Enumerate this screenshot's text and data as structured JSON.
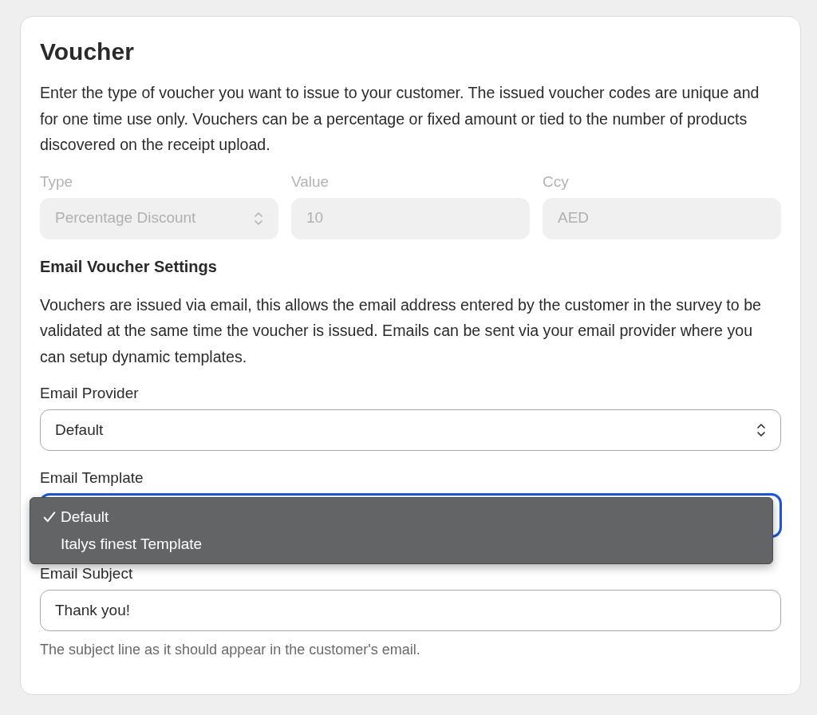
{
  "title": "Voucher",
  "intro": "Enter the type of voucher you want to issue to your customer. The issued voucher codes are unique and for one time use only. Vouchers can be a percentage or fixed amount or tied to the number of products discovered on the receipt upload.",
  "voucher_fields": [
    {
      "label": "Type",
      "kind": "select",
      "value": "Percentage Discount",
      "disabled": true
    },
    {
      "label": "Value",
      "kind": "input",
      "value": "10",
      "disabled": true
    },
    {
      "label": "Ccy",
      "kind": "input",
      "value": "AED",
      "disabled": true
    }
  ],
  "email_section": {
    "heading": "Email Voucher Settings",
    "description": "Vouchers are issued via email, this allows the email address entered by the customer in the survey to be validated at the same time the voucher is issued. Emails can be sent via your email provider where you can setup dynamic templates."
  },
  "email_provider": {
    "label": "Email Provider",
    "value": "Default"
  },
  "email_template": {
    "label": "Email Template",
    "focused": true,
    "menu": [
      {
        "label": "Default",
        "selected": true
      },
      {
        "label": "Italys finest Template",
        "selected": false
      }
    ]
  },
  "email_subject": {
    "label": "Email Subject",
    "value": "Thank you!",
    "help": "The subject line as it should appear in the customer's email."
  }
}
